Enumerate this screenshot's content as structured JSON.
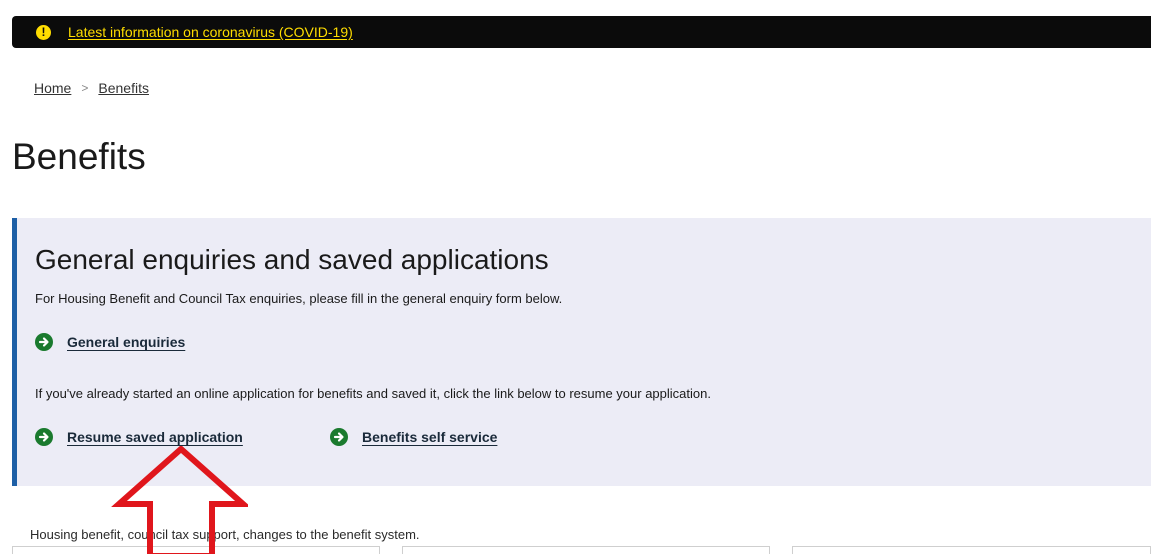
{
  "alert": {
    "icon": "warning-icon",
    "link_text": "Latest information on coronavirus (COVID-19)"
  },
  "breadcrumb": {
    "items": [
      "Home",
      "Benefits"
    ],
    "separator": ">"
  },
  "page": {
    "title": "Benefits"
  },
  "panel": {
    "heading": "General enquiries and saved applications",
    "intro": "For Housing Benefit and Council Tax enquiries, please fill in the general enquiry form below.",
    "general_enquiries_link": "General enquiries",
    "resume_text": "If you've already started an online application for benefits and saved it, click the link below to resume your application.",
    "resume_link": "Resume saved application",
    "self_service_link": "Benefits self service",
    "link_icon": "arrow-right-circle-icon"
  },
  "section": {
    "intro": "Housing benefit, council tax support, changes to the benefit system."
  },
  "colors": {
    "alert_background": "#0b0b0b",
    "alert_link": "#ffdd00",
    "panel_background": "#ececf6",
    "panel_border": "#1d5fa6",
    "link_icon": "#1a7a2e",
    "annotation_arrow": "#e0161c"
  }
}
